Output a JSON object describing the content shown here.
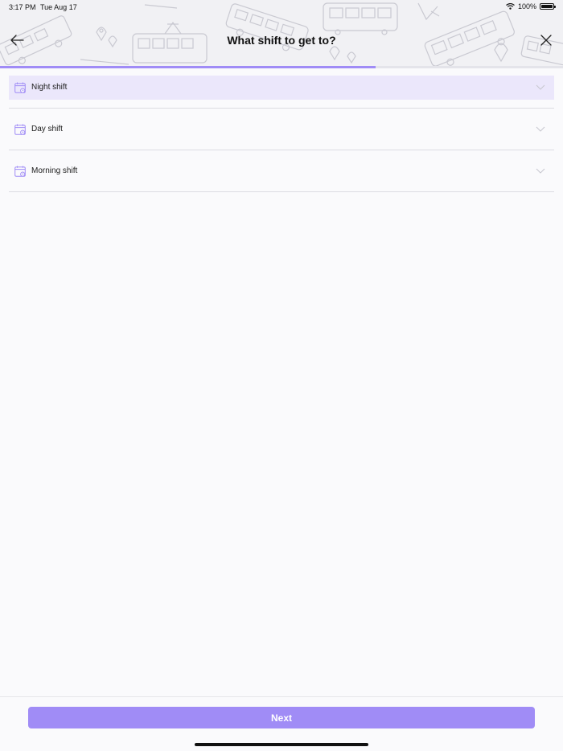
{
  "status_bar": {
    "time": "3:17 PM",
    "date": "Tue Aug 17",
    "battery_percent": "100%"
  },
  "header": {
    "title": "What shift to get to?",
    "back_icon": "arrow-left-icon",
    "close_icon": "close-icon",
    "progress": 0.667
  },
  "shifts": [
    {
      "label": "Night shift",
      "icon": "calendar-clock-icon",
      "selected": true
    },
    {
      "label": "Day shift",
      "icon": "calendar-clock-icon",
      "selected": false
    },
    {
      "label": "Morning shift",
      "icon": "calendar-clock-icon",
      "selected": false
    }
  ],
  "footer": {
    "next_label": "Next"
  },
  "colors": {
    "accent": "#a08cf6",
    "selected_row": "#ebe7fb",
    "icon_stroke": "#a08cf6",
    "chevron": "#c8c8d0"
  }
}
